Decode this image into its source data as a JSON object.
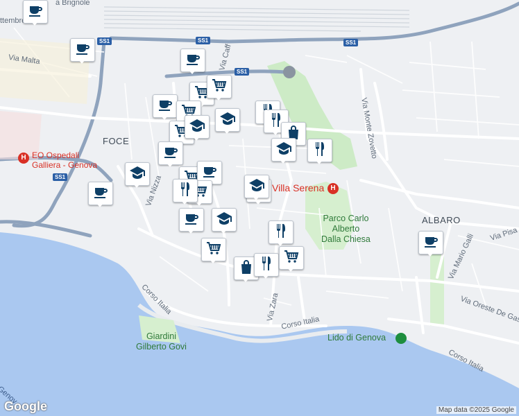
{
  "map": {
    "colors": {
      "sea": "#aac8f0",
      "land": "#eef0f3",
      "park": "#cdebc6",
      "road": "#ffffff",
      "highway": "#8fa3bd",
      "pin_icon": "#0e3f66",
      "hospital": "#d93025"
    },
    "labels": {
      "foce": "FOCE",
      "albaro": "ALBARO",
      "settembre": "ttembre",
      "via_malta": "Via Malta",
      "via_nizza": "Via Nizza",
      "via_caffa": "Via Caff",
      "via_monte_zovetto": "Via Monte Zovetto",
      "via_pisa": "Via Pisa",
      "via_mario_galli": "Via Mario Galli",
      "via_oreste": "Via Oreste De Gas",
      "via_zara": "Via Zara",
      "corso_italia_w": "Corso Italia",
      "corso_italia_c": "Corso Italia",
      "corso_italia_e": "Corso Italia",
      "brignole": "a Brignole",
      "genova_w": "Genov"
    },
    "places": {
      "hospital_galliera": "EO Ospedali\nGalliera - Genova",
      "villa_serena": "Villa Serena",
      "parco": "Parco Carlo\nAlberto\nDalla Chiesa",
      "giardini": "Giardini\nGilberto Govi",
      "lido": "Lido di Genova"
    },
    "shields": [
      "SS1",
      "SS1",
      "SS1",
      "SS1",
      "SS1"
    ],
    "attribution": "Map data ©2025 Google",
    "logo": "Google",
    "markers": [
      {
        "icon": "cafe-icon"
      },
      {
        "icon": "cafe-icon"
      },
      {
        "icon": "cafe-icon"
      },
      {
        "icon": "shopping-cart-icon"
      },
      {
        "icon": "shopping-cart-icon"
      },
      {
        "icon": "cafe-icon"
      },
      {
        "icon": "shopping-cart-icon"
      },
      {
        "icon": "restaurant-icon"
      },
      {
        "icon": "restaurant-icon"
      },
      {
        "icon": "shopping-cart-icon"
      },
      {
        "icon": "school-icon"
      },
      {
        "icon": "school-icon"
      },
      {
        "icon": "shopping-bag-icon"
      },
      {
        "icon": "school-icon"
      },
      {
        "icon": "restaurant-icon"
      },
      {
        "icon": "cafe-icon"
      },
      {
        "icon": "school-icon"
      },
      {
        "icon": "shopping-cart-icon"
      },
      {
        "icon": "cafe-icon"
      },
      {
        "icon": "shopping-cart-icon"
      },
      {
        "icon": "restaurant-icon"
      },
      {
        "icon": "school-icon"
      },
      {
        "icon": "school-icon"
      },
      {
        "icon": "cafe-icon"
      },
      {
        "icon": "school-icon"
      },
      {
        "icon": "shopping-cart-icon"
      },
      {
        "icon": "restaurant-icon"
      },
      {
        "icon": "shopping-bag-icon"
      },
      {
        "icon": "restaurant-icon"
      },
      {
        "icon": "shopping-cart-icon"
      },
      {
        "icon": "cafe-icon"
      },
      {
        "icon": "cafe-icon"
      }
    ]
  }
}
